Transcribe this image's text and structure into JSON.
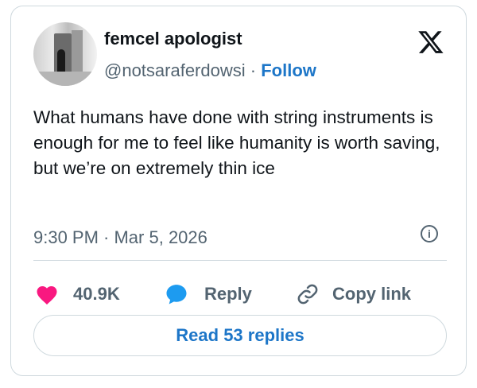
{
  "tweet": {
    "author_name": "femcel apologist",
    "handle": "@notsaraferdowsi",
    "separator": "·",
    "follow_label": "Follow",
    "text": "What humans have done with string instruments is enough for me to feel like humanity is worth saving, but we’re on extremely thin ice",
    "timestamp": "9:30 PM · Mar 5, 2026",
    "info_icon": "i"
  },
  "actions": {
    "like_count": "40.9K",
    "reply_label": "Reply",
    "copy_link_label": "Copy link"
  },
  "replies": {
    "read_label": "Read 53 replies"
  },
  "colors": {
    "accent": "#1d76c8",
    "like": "#f91880",
    "reply_icon": "#1d9bf0",
    "muted": "#536471",
    "border": "#cfd9de"
  },
  "icons": [
    "x-logo-icon",
    "heart-icon",
    "reply-bubble-icon",
    "link-icon",
    "info-icon"
  ]
}
